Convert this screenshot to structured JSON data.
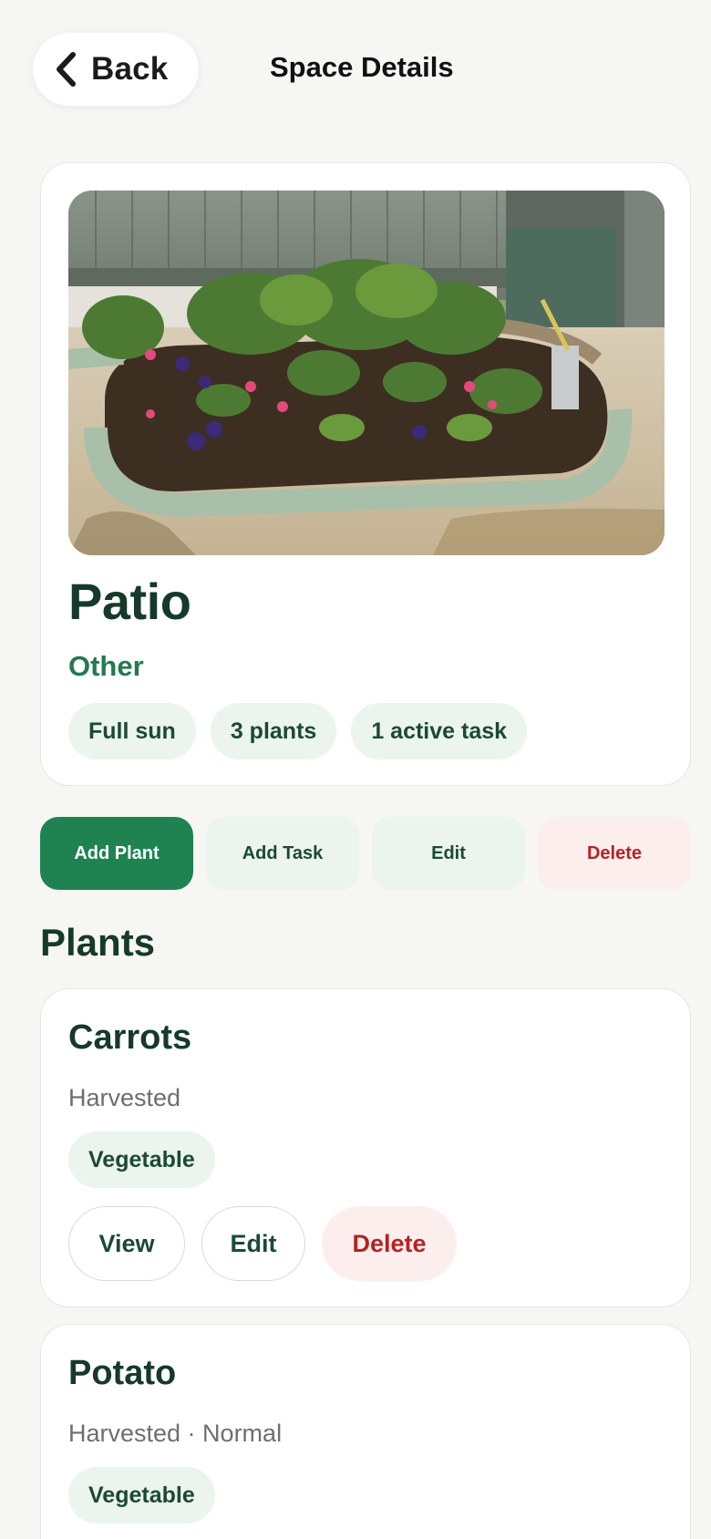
{
  "header": {
    "back_label": "Back",
    "title": "Space Details"
  },
  "space": {
    "name": "Patio",
    "type": "Other",
    "chips": [
      "Full sun",
      "3 plants",
      "1 active task"
    ]
  },
  "actions": {
    "add_plant": "Add Plant",
    "add_task": "Add Task",
    "edit": "Edit",
    "delete": "Delete"
  },
  "plants_section": {
    "title": "Plants",
    "items": [
      {
        "name": "Carrots",
        "status": "Harvested",
        "category": "Vegetable",
        "view_label": "View",
        "edit_label": "Edit",
        "delete_label": "Delete"
      },
      {
        "name": "Potato",
        "status": "Harvested · Normal",
        "category": "Vegetable"
      }
    ]
  },
  "colors": {
    "background": "#f6f6f4",
    "primary_green": "#1e8350",
    "dark_green_text": "#163a2a",
    "chip_bg": "#ecf4ee",
    "danger_text": "#b52322",
    "danger_bg": "#fdeeee"
  },
  "icons": {
    "back": "chevron-left-icon"
  }
}
